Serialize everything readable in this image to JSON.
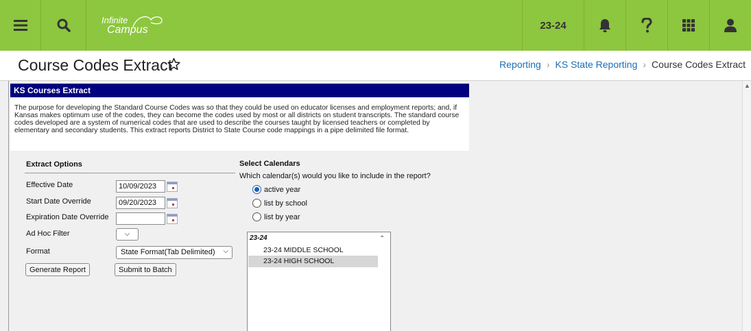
{
  "topbar": {
    "logo_line1": "Infinite",
    "logo_line2": "Campus",
    "school_year": "23-24",
    "icons": [
      "menu-icon",
      "search-icon",
      "bell-icon",
      "help-icon",
      "apps-grid-icon",
      "user-icon"
    ],
    "color": "#8dc63f"
  },
  "page": {
    "title": "Course Codes Extract",
    "breadcrumb": [
      "Reporting",
      "KS State Reporting",
      "Course Codes Extract"
    ]
  },
  "panel": {
    "header": "KS Courses Extract",
    "header_color": "#000080",
    "description": "The purpose for developing the Standard Course Codes was so that they could be used on educator licenses and employment reports; and, if Kansas makes optimum use of the codes, they can become the codes used by most or all districts on student transcripts. The standard course codes developed are a system of numerical codes that are used to describe the courses taught by licensed teachers or completed by elementary and secondary students. This extract reports District to State Course code mappings in a pipe delimited file format."
  },
  "extract_options": {
    "title": "Extract Options",
    "effective_date_label": "Effective Date",
    "effective_date_value": "10/09/2023",
    "start_date_label": "Start Date Override",
    "start_date_value": "09/20/2023",
    "expiration_date_label": "Expiration Date Override",
    "expiration_date_value": "",
    "ad_hoc_label": "Ad Hoc Filter",
    "ad_hoc_value": "",
    "format_label": "Format",
    "format_value": "State Format(Tab Delimited)",
    "generate_button": "Generate Report",
    "batch_button": "Submit to Batch"
  },
  "calendars": {
    "title": "Select Calendars",
    "question": "Which calendar(s) would you like to include in the report?",
    "options": [
      "active year",
      "list by school",
      "list by year"
    ],
    "selected_option": "active year",
    "list_group": "23-24",
    "list_items": [
      "23-24 MIDDLE SCHOOL",
      "23-24 HIGH SCHOOL"
    ],
    "selected_item": "23-24 HIGH SCHOOL"
  }
}
